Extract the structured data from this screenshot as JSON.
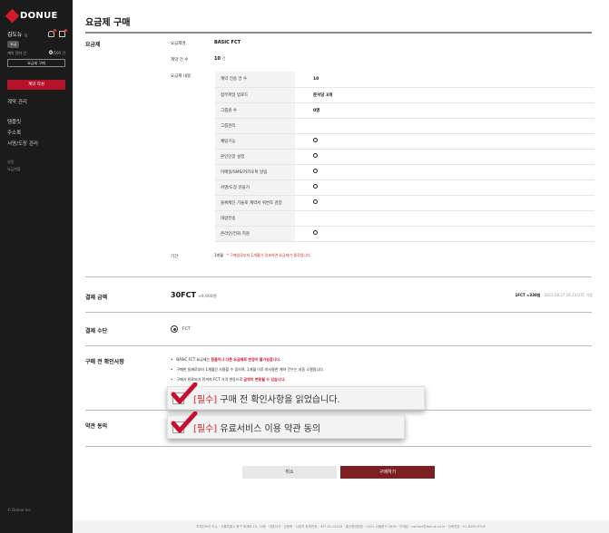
{
  "sidebar": {
    "logo": "DONUE",
    "user_name": "김도뉴",
    "user_suffix": "님",
    "plan_badge": "요금",
    "credit_label": "계약 잔여 건",
    "credit_value": "0",
    "credit_total": "/500 건",
    "plan_buy": "요금제 구매",
    "write_button": "계약 작성",
    "nav": [
      "계약 관리",
      "템플릿",
      "주소록",
      "서명/도장 관리"
    ],
    "sub_nav": [
      "설정",
      "요금현황"
    ],
    "copyright": "© Donue Inc."
  },
  "page": {
    "title": "요금제 구매"
  },
  "plan_section": {
    "title": "요금제",
    "plan_label": "요금제명",
    "plan_value": "BASIC FCT",
    "count_label": "계약 건 수",
    "count_value": "10",
    "count_unit": "건",
    "content_label": "요금제 내용",
    "rows": [
      {
        "k": "계약 전송 건 수",
        "v": "10",
        "circle": false
      },
      {
        "k": "첨부파일 업로드",
        "v": "문서당 3개",
        "circle": false
      },
      {
        "k": "그룹원 수",
        "v": "0명",
        "circle": false
      },
      {
        "k": "그룹관리",
        "v": "",
        "circle": false
      },
      {
        "k": "채팅기능",
        "v": "",
        "circle": true
      },
      {
        "k": "본인인증 설정",
        "v": "",
        "circle": true
      },
      {
        "k": "이메일/SMS/카카오톡 알림",
        "v": "",
        "circle": true
      },
      {
        "k": "서명/도장 만들기",
        "v": "",
        "circle": true
      },
      {
        "k": "블록체인 기술로 계약서 위변조 검증",
        "v": "",
        "circle": true
      },
      {
        "k": "대량전송",
        "v": "",
        "circle": false
      },
      {
        "k": "온라인/전화 지원",
        "v": "",
        "circle": true
      }
    ],
    "period_label": "기간",
    "period_value": "1개월",
    "period_warning": "* 구매일로부터 1개월이 경과하면 요금제가 종료됩니다."
  },
  "payment": {
    "title": "결제 금액",
    "amount": "30FCT",
    "amount_won": "≈9,900원",
    "rate": "1FCT ≈330원",
    "rate_time": "2022.08.27 16:23 UTC 기준"
  },
  "method": {
    "title": "결제 수단",
    "option": "FCT"
  },
  "notice": {
    "title": "구매 전 확인사항",
    "items": [
      {
        "pre": "BASIC FCT 요금제는 ",
        "red": "환불이나 다른 요금제로 변경이 불가능합니다.",
        "post": ""
      },
      {
        "pre": "구매한 날짜로부터 1개월간 사용할 수 있으며, 1개월 이후 미사용한 계약 건수는 자동 소멸됩니다.",
        "red": "",
        "post": ""
      },
      {
        "pre": "구매가 완료되기 전까지 FCT 가격 변동으로 ",
        "red": "금액이 변동될 수 있습니다.",
        "post": ""
      }
    ],
    "confirm_required": "[필수]",
    "confirm_text": " 구매 전 확인사항을 읽었습니다."
  },
  "terms": {
    "title": "약관 동의",
    "required": "[필수]",
    "text": " 유료서비스 이용 약관 동의"
  },
  "buttons": {
    "cancel": "취소",
    "buy": "구매하기"
  },
  "footer": "투체인브라 도뉴 · 서울특별시 중구 퇴계로 10, 14층 · 대표이사 : 김동현 · 사업자 등록번호 : 447-81-02244 · 통신판매번호 : 2021-서울중구-1839 · 이메일 : contact@donue.co.kr · 전화번호 : 02-6290-5300",
  "colors": {
    "accent": "#b5122a",
    "buy": "#7a1f22",
    "warn": "#d11a2a",
    "sidebar": "#1b1b1b"
  }
}
